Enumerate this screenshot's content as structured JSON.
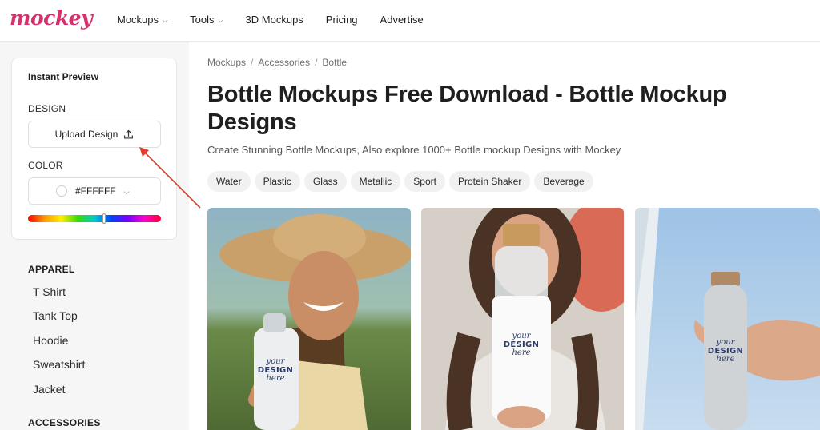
{
  "brand": {
    "logo_text": "mockey",
    "accent_color": "#d6306f"
  },
  "nav": {
    "items": [
      {
        "label": "Mockups",
        "has_dropdown": true
      },
      {
        "label": "Tools",
        "has_dropdown": true
      },
      {
        "label": "3D Mockups",
        "has_dropdown": false
      },
      {
        "label": "Pricing",
        "has_dropdown": false
      },
      {
        "label": "Advertise",
        "has_dropdown": false
      }
    ]
  },
  "preview": {
    "title": "Instant Preview",
    "design_label": "DESIGN",
    "upload_label": "Upload Design",
    "color_label": "COLOR",
    "color_value": "#FFFFFF",
    "hue_position": 0.57
  },
  "sidebar": {
    "sections": [
      {
        "heading": "APPAREL",
        "items": [
          "T Shirt",
          "Tank Top",
          "Hoodie",
          "Sweatshirt",
          "Jacket"
        ]
      },
      {
        "heading": "ACCESSORIES",
        "items": []
      }
    ]
  },
  "breadcrumb": [
    "Mockups",
    "Accessories",
    "Bottle"
  ],
  "page": {
    "title": "Bottle Mockups Free Download - Bottle Mockup Designs",
    "subtitle": "Create Stunning Bottle Mockups, Also explore 1000+ Bottle mockup Designs with Mockey"
  },
  "tags": [
    "Water",
    "Plastic",
    "Glass",
    "Metallic",
    "Sport",
    "Protein Shaker",
    "Beverage"
  ],
  "mockups": [
    {
      "design_text_top": "your",
      "design_text_mid": "DESIGN",
      "design_text_bottom": "here"
    },
    {
      "design_text_top": "your",
      "design_text_mid": "DESIGN",
      "design_text_bottom": "here"
    },
    {
      "design_text_top": "your",
      "design_text_mid": "DESIGN",
      "design_text_bottom": "here"
    }
  ]
}
